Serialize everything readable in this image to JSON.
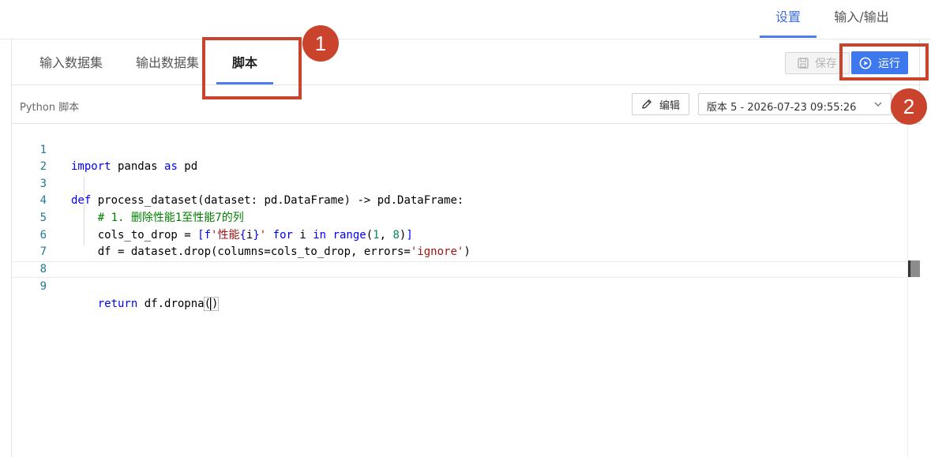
{
  "top_tabs": [
    {
      "label": "设置",
      "active": true
    },
    {
      "label": "输入/输出",
      "active": false
    }
  ],
  "sub_tabs": [
    {
      "label": "输入数据集"
    },
    {
      "label": "输出数据集"
    },
    {
      "label": "脚本"
    }
  ],
  "toolbar": {
    "save_label": "保存",
    "run_label": "运行"
  },
  "script": {
    "label": "Python 脚本",
    "edit_label": "编辑",
    "version": "版本 5 - 2026-07-23 09:55:26"
  },
  "code_lines": [
    {
      "n": "1",
      "text": "import pandas as pd"
    },
    {
      "n": "2",
      "text": ""
    },
    {
      "n": "3",
      "text": "def process_dataset(dataset: pd.DataFrame) -> pd.DataFrame:"
    },
    {
      "n": "4",
      "text": "    # 1. 删除性能1至性能7的列"
    },
    {
      "n": "5",
      "text": "    cols_to_drop = [f'性能{i}' for i in range(1, 8)]"
    },
    {
      "n": "6",
      "text": "    df = dataset.drop(columns=cols_to_drop, errors='ignore')"
    },
    {
      "n": "7",
      "text": ""
    },
    {
      "n": "8",
      "text": ""
    },
    {
      "n": "9",
      "text": "    return df.dropna()"
    }
  ],
  "annotations": [
    {
      "label": "1",
      "target": "sub-tab-script"
    },
    {
      "label": "2",
      "target": "run-button"
    }
  ],
  "colors": {
    "accent": "#3d78ef",
    "annotation": "#c9432d"
  }
}
